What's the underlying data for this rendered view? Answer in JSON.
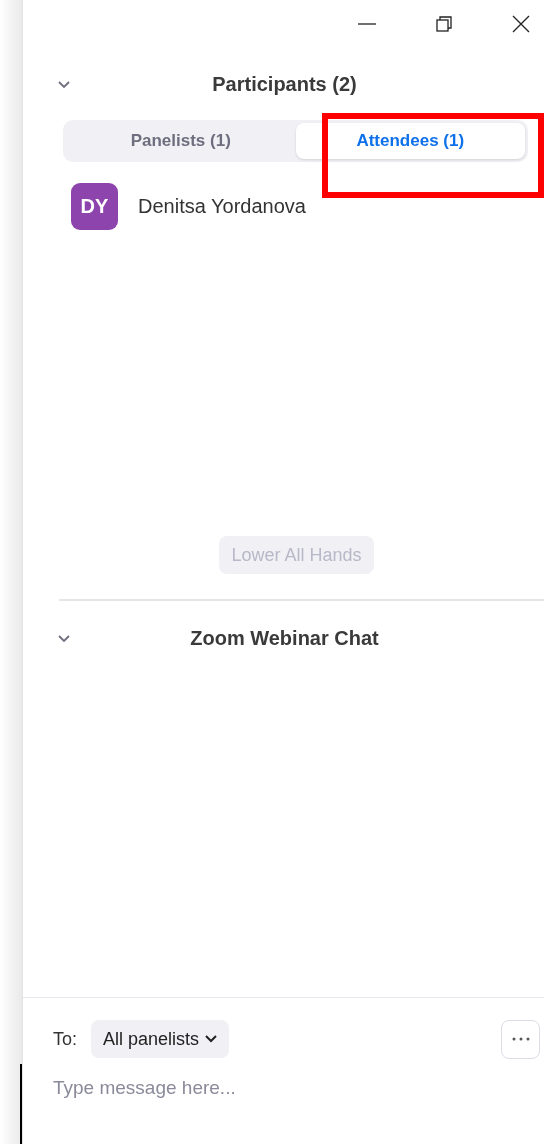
{
  "participants": {
    "title": "Participants (2)",
    "expanded": true,
    "tabs": [
      {
        "label": "Panelists (1)",
        "selected": false
      },
      {
        "label": "Attendees (1)",
        "selected": true
      }
    ],
    "list": [
      {
        "initials": "DY",
        "name": "Denitsa Yordanova",
        "color": "#8e44ad"
      }
    ],
    "lower_hands": {
      "label": "Lower All Hands",
      "disabled": true
    }
  },
  "chat": {
    "title": "Zoom Webinar Chat",
    "expanded": true,
    "to_label": "To:",
    "recipient": "All panelists",
    "placeholder": "Type message here..."
  }
}
